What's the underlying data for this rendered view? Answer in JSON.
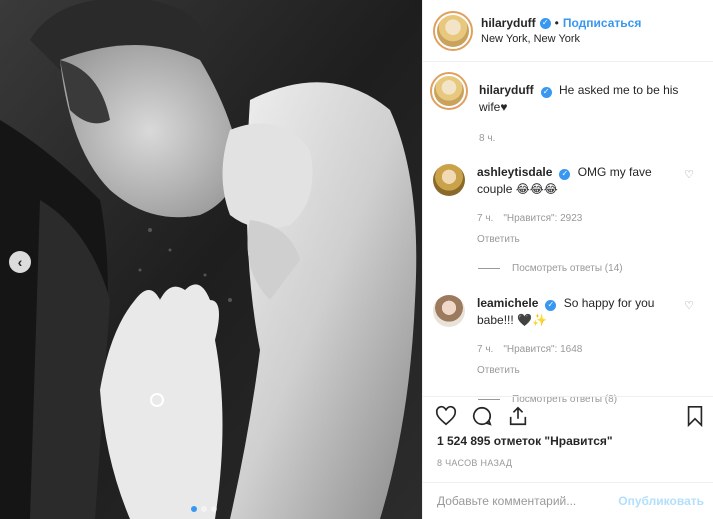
{
  "post": {
    "author": "hilaryduff",
    "follow_label": "Подписаться",
    "separator": "•",
    "location": "New York, New York",
    "caption": "He asked me to be his wife♥",
    "caption_time": "8 ч."
  },
  "comments": [
    {
      "user": "ashleytisdale",
      "text": "OMG my fave couple 😂😂😂",
      "time": "7 ч.",
      "likes": "\"Нравится\": 2923",
      "reply_label": "Ответить",
      "view_replies": "Посмотреть ответы (14)"
    },
    {
      "user": "leamichele",
      "text": "So happy for you babe!!! 🖤✨",
      "time": "7 ч.",
      "likes": "\"Нравится\": 1648",
      "reply_label": "Ответить",
      "view_replies": "Посмотреть ответы (8)"
    }
  ],
  "likes_text": "1 524 895 отметок \"Нравится\"",
  "time_ago": "8 ЧАСОВ НАЗАД",
  "add_comment": {
    "placeholder": "Добавьте комментарий...",
    "publish_label": "Опубликовать"
  },
  "carousel": {
    "total": 3,
    "current": 1
  },
  "colors": {
    "accent": "#3897f0",
    "publish_disabled": "#b2dffc",
    "muted": "#999999"
  }
}
